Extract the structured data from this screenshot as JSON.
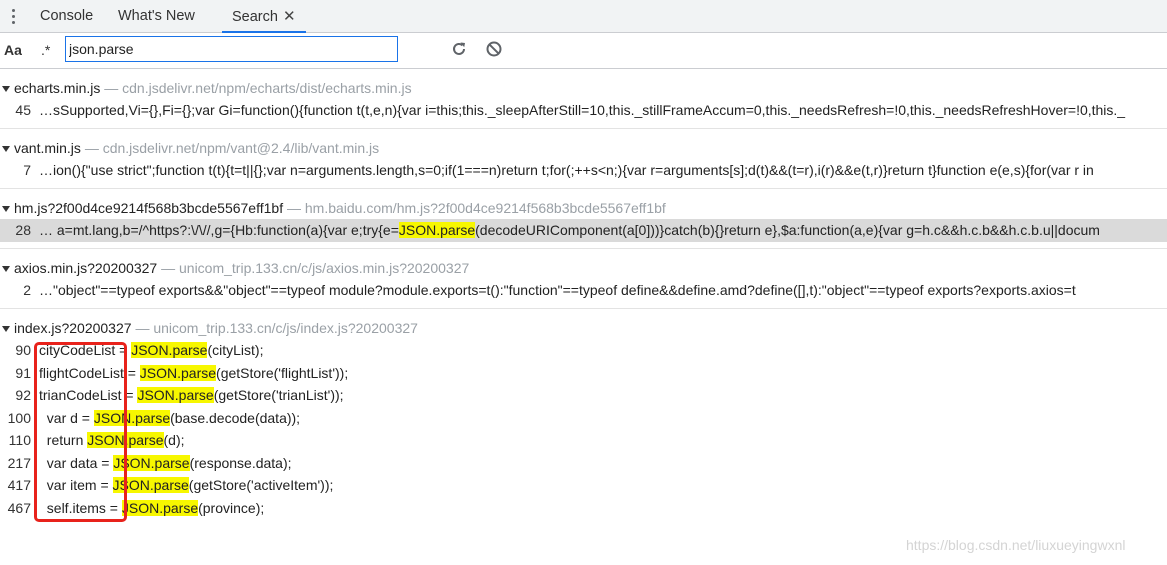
{
  "tabs": [
    {
      "label": "Console",
      "active": false
    },
    {
      "label": "What's New",
      "active": false
    },
    {
      "label": "Search",
      "active": true,
      "close": "✕"
    }
  ],
  "toolbar": {
    "match_case_label": "Aa",
    "regex_label": ".*",
    "query": "json.parse",
    "refresh_icon": "refresh-icon",
    "clear_icon": "clear-icon"
  },
  "results": [
    {
      "file": "echarts.min.js",
      "path": "— cdn.jsdelivr.net/npm/echarts/dist/echarts.min.js",
      "matches": [
        {
          "line": "45",
          "pre": "…sSupported,Vi={},Fi={};var Gi=function(){function t(t,e,n){var i=this;this._sleepAfterStill=10,this._stillFrameAccum=0,this._needsRefresh=!0,this._needsRefreshHover=!0,this._",
          "hl": "",
          "post": ""
        }
      ]
    },
    {
      "file": "vant.min.js",
      "path": "— cdn.jsdelivr.net/npm/vant@2.4/lib/vant.min.js",
      "matches": [
        {
          "line": "7",
          "pre": "…ion(){\"use strict\";function t(t){t=t||{};var n=arguments.length,s=0;if(1===n)return t;for(;++s<n;){var r=arguments[s];d(t)&&(t=r),i(r)&&e(t,r)}return t}function e(e,s){for(var r in",
          "hl": "",
          "post": ""
        }
      ]
    },
    {
      "file": "hm.js?2f00d4ce9214f568b3bcde5567eff1bf",
      "path": "— hm.baidu.com/hm.js?2f00d4ce9214f568b3bcde5567eff1bf",
      "matches": [
        {
          "line": "28",
          "pre": "… a=mt.lang,b=/^https?:\\/\\//,g={Hb:function(a){var e;try{e=",
          "hl": "JSON.parse",
          "post": "(decodeURIComponent(a[0]))}catch(b){}return e},$a:function(a,e){var g=h.c&&h.c.b&&h.c.b.u||docum",
          "selected": true
        }
      ]
    },
    {
      "file": "axios.min.js?20200327",
      "path": "— unicom_trip.133.cn/c/js/axios.min.js?20200327",
      "matches": [
        {
          "line": "2",
          "pre": "…\"object\"==typeof exports&&\"object\"==typeof module?module.exports=t():\"function\"==typeof define&&define.amd?define([],t):\"object\"==typeof exports?exports.axios=t",
          "hl": "",
          "post": ""
        }
      ]
    },
    {
      "file": "index.js?20200327",
      "path": "— unicom_trip.133.cn/c/js/index.js?20200327",
      "matches": [
        {
          "line": "90",
          "pre": "cityCodeList = ",
          "hl": "JSON.parse",
          "post": "(cityList);"
        },
        {
          "line": "91",
          "pre": "flightCodeList = ",
          "hl": "JSON.parse",
          "post": "(getStore('flightList'));"
        },
        {
          "line": "92",
          "pre": "trianCodeList = ",
          "hl": "JSON.parse",
          "post": "(getStore('trianList'));"
        },
        {
          "line": "100",
          "pre": "  var d = ",
          "hl": "JSON.parse",
          "post": "(base.decode(data));"
        },
        {
          "line": "110",
          "pre": "  return ",
          "hl": "JSON.parse",
          "post": "(d);"
        },
        {
          "line": "217",
          "pre": "  var data = ",
          "hl": "JSON.parse",
          "post": "(response.data);"
        },
        {
          "line": "417",
          "pre": "  var item = ",
          "hl": "JSON.parse",
          "post": "(getStore('activeItem'));"
        },
        {
          "line": "467",
          "pre": "  self.items = ",
          "hl": "JSON.parse",
          "post": "(province);"
        }
      ]
    }
  ],
  "watermark": "https://blog.csdn.net/liuxueyingwxnl",
  "colors": {
    "highlight": "#f7f700",
    "selected_row": "#dadada",
    "annotation_box": "#e8221b",
    "focus_blue": "#1a73e8"
  }
}
